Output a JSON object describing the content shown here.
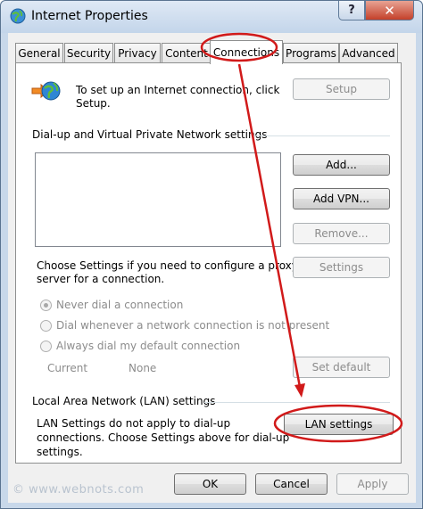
{
  "window": {
    "title": "Internet Properties",
    "help_glyph": "?",
    "close_glyph": "✕"
  },
  "tabs": [
    "General",
    "Security",
    "Privacy",
    "Content",
    "Connections",
    "Programs",
    "Advanced"
  ],
  "setup": {
    "text_line1": "To set up an Internet connection, click",
    "text_line2": "Setup.",
    "button": "Setup"
  },
  "dialup": {
    "heading": "Dial-up and Virtual Private Network settings",
    "add_button": "Add...",
    "add_vpn_button": "Add VPN...",
    "remove_button": "Remove...",
    "proxy_text_line1": "Choose Settings if you need to configure a proxy",
    "proxy_text_line2": "server for a connection.",
    "settings_button": "Settings",
    "radio_never": "Never dial a connection",
    "radio_whenever": "Dial whenever a network connection is not present",
    "radio_always": "Always dial my default connection",
    "current_label": "Current",
    "current_value": "None",
    "set_default_button": "Set default"
  },
  "lan": {
    "heading": "Local Area Network (LAN) settings",
    "text_line1": "LAN Settings do not apply to dial-up",
    "text_line2": "connections. Choose Settings above for dial-up",
    "text_line3": "settings.",
    "button": "LAN settings"
  },
  "footer": {
    "ok": "OK",
    "cancel": "Cancel",
    "apply": "Apply"
  },
  "watermark": "© www.webnots.com",
  "colors": {
    "annotation": "#d11a1a",
    "title_bar": "#c8d8ea"
  }
}
